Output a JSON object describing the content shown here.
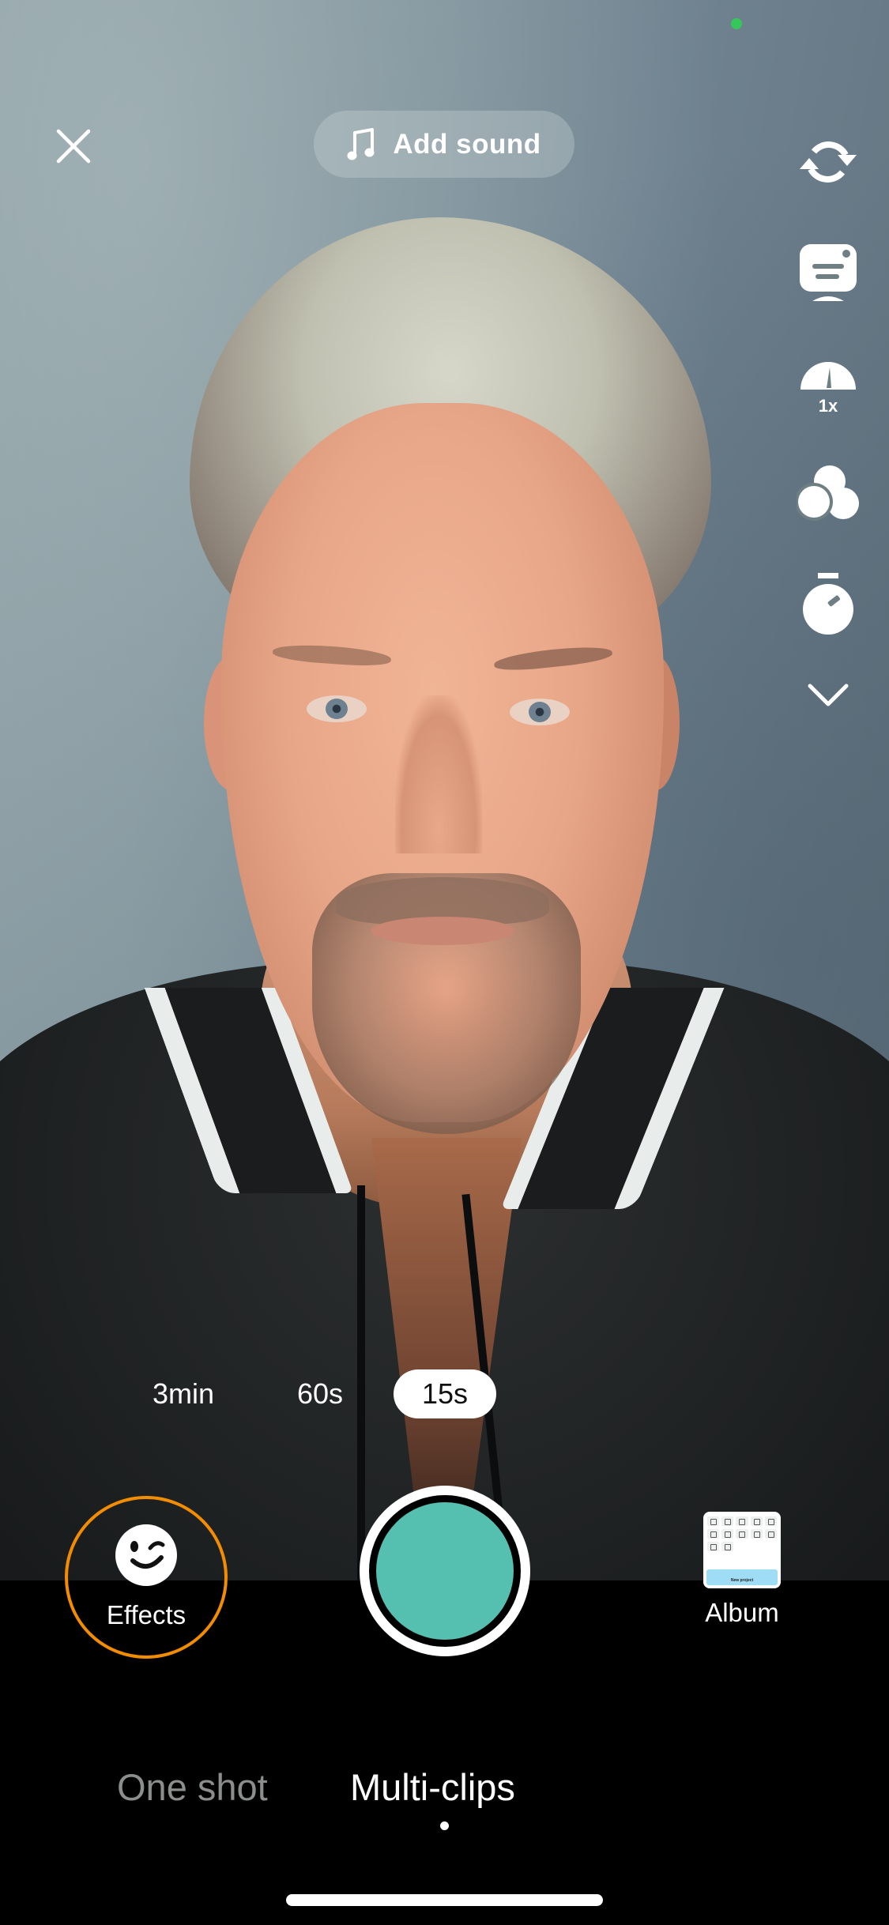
{
  "status": {
    "privacy_indicator_color": "#34c759"
  },
  "top_bar": {
    "close_icon": "close-icon",
    "add_sound": {
      "icon": "music-note-icon",
      "label": "Add sound"
    }
  },
  "side_tools": [
    {
      "name": "flip-camera",
      "icon": "flip-camera-icon"
    },
    {
      "name": "captions",
      "icon": "captions-monitor-icon"
    },
    {
      "name": "speed",
      "icon": "speed-gauge-icon",
      "value": "1x"
    },
    {
      "name": "filters",
      "icon": "filters-icon"
    },
    {
      "name": "timer",
      "icon": "timer-icon"
    },
    {
      "name": "more",
      "icon": "chevron-down-icon"
    }
  ],
  "durations": {
    "options": [
      "3min",
      "60s",
      "15s"
    ],
    "selected": "15s"
  },
  "capture": {
    "effects": {
      "icon": "wink-face-icon",
      "label": "Effects",
      "ring_color": "#f28c00"
    },
    "record_button": {
      "color": "#55bfb0"
    },
    "album": {
      "label": "Album",
      "thumbnail_button": "New project"
    }
  },
  "modes": {
    "items": [
      "One shot",
      "Multi-clips"
    ],
    "active": "Multi-clips"
  },
  "colors": {
    "active_text": "#ffffff",
    "inactive_text": "#8a8e8c",
    "background": "#000000"
  }
}
